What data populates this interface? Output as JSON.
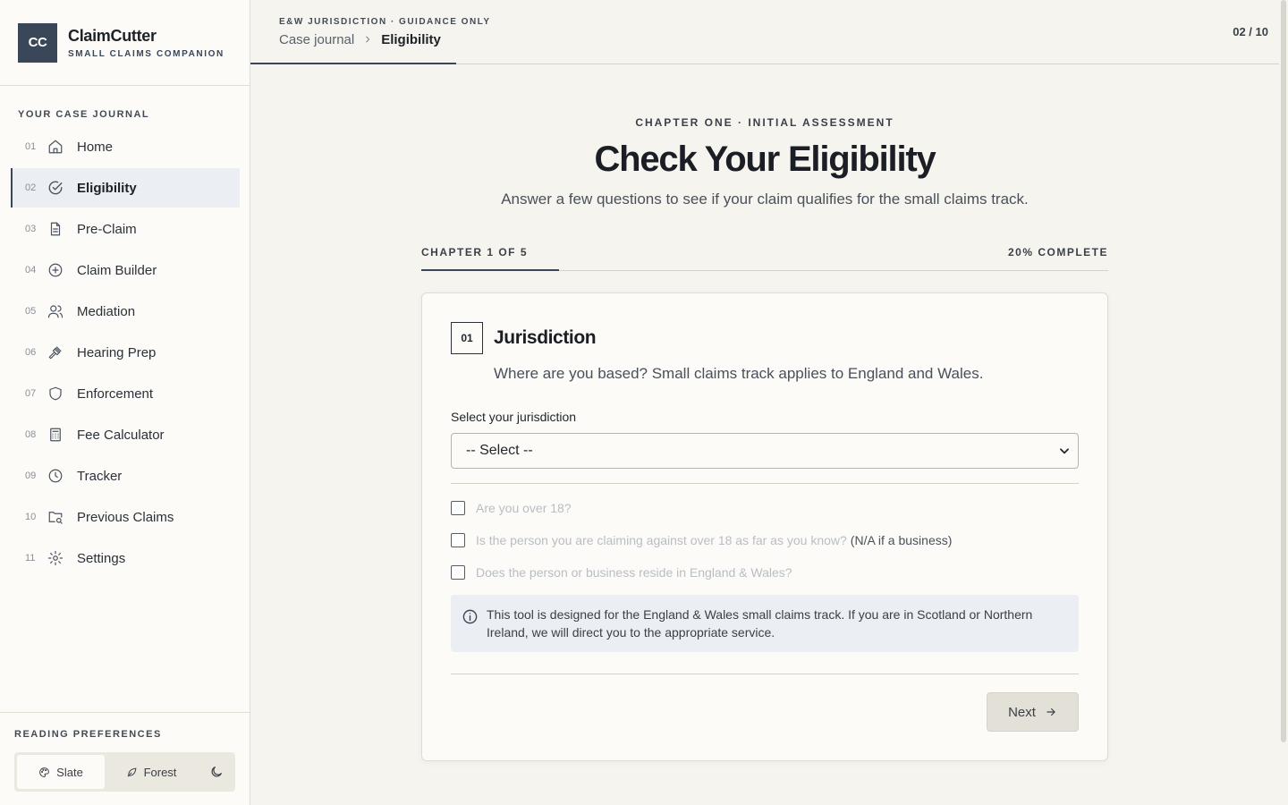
{
  "brand": {
    "logo": "CC",
    "name": "ClaimCutter",
    "tagline": "SMALL CLAIMS COMPANION"
  },
  "nav": {
    "title": "YOUR CASE JOURNAL",
    "items": [
      {
        "num": "01",
        "label": "Home",
        "icon": "home-icon"
      },
      {
        "num": "02",
        "label": "Eligibility",
        "icon": "check-circle-icon",
        "active": true
      },
      {
        "num": "03",
        "label": "Pre-Claim",
        "icon": "document-icon"
      },
      {
        "num": "04",
        "label": "Claim Builder",
        "icon": "plus-circle-icon"
      },
      {
        "num": "05",
        "label": "Mediation",
        "icon": "users-icon"
      },
      {
        "num": "06",
        "label": "Hearing Prep",
        "icon": "gavel-icon"
      },
      {
        "num": "07",
        "label": "Enforcement",
        "icon": "shield-icon"
      },
      {
        "num": "08",
        "label": "Fee Calculator",
        "icon": "calculator-icon"
      },
      {
        "num": "09",
        "label": "Tracker",
        "icon": "clock-icon"
      },
      {
        "num": "10",
        "label": "Previous Claims",
        "icon": "folder-search-icon"
      },
      {
        "num": "11",
        "label": "Settings",
        "icon": "gear-icon"
      }
    ]
  },
  "prefs": {
    "title": "READING PREFERENCES",
    "slate": "Slate",
    "forest": "Forest"
  },
  "topbar": {
    "eyebrow": "E&W JURISDICTION · GUIDANCE ONLY",
    "crumb_parent": "Case journal",
    "crumb_current": "Eligibility",
    "page_count": "02 / 10"
  },
  "hero": {
    "eyebrow": "CHAPTER ONE · INITIAL ASSESSMENT",
    "title": "Check Your Eligibility",
    "subtitle": "Answer a few questions to see if your claim qualifies for the small claims track."
  },
  "progress": {
    "chapter": "CHAPTER 1 OF 5",
    "complete": "20% COMPLETE",
    "fraction": 0.2
  },
  "step": {
    "badge": "01",
    "title": "Jurisdiction",
    "description": "Where are you based? Small claims track applies to England and Wales.",
    "field_label": "Select your jurisdiction",
    "select_value": "-- Select --",
    "checks": [
      {
        "text": "Are you over 18?",
        "extra": ""
      },
      {
        "text": "Is the person you are claiming against over 18 as far as you know?",
        "extra": "(N/A if a business)"
      },
      {
        "text": "Does the person or business reside in England & Wales?",
        "extra": ""
      }
    ],
    "info": "This tool is designed for the England & Wales small claims track. If you are in Scotland or Northern Ireland, we will direct you to the appropriate service.",
    "next_label": "Next"
  },
  "colors": {
    "accent": "#3a4759",
    "background": "#f6f4ee",
    "info_bg": "#ebeef3"
  }
}
